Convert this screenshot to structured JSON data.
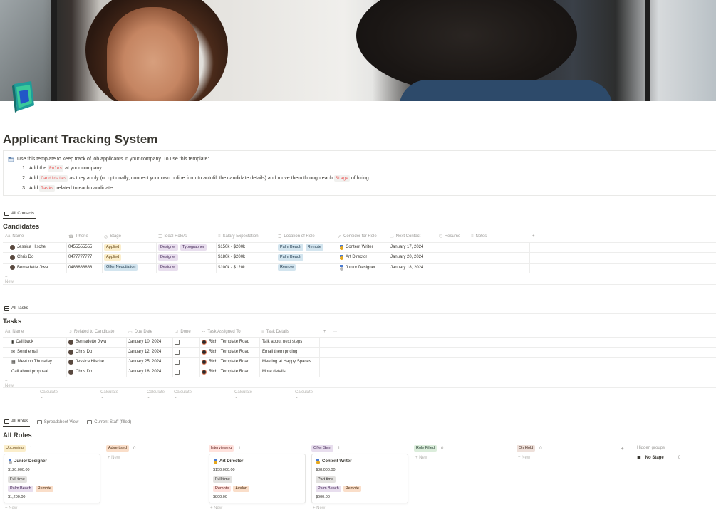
{
  "page": {
    "title": "Applicant Tracking System"
  },
  "callout": {
    "intro": "Use this template to keep track of job applicants in your company. To use this template:",
    "steps": [
      {
        "n": "1.",
        "before": "Add the",
        "code": "Roles",
        "after": "at your company"
      },
      {
        "n": "2.",
        "before": "Add",
        "code": "Candidates",
        "middle": "as they apply (or optionally, connect your own online form to autofill the candidate details) and move them through each",
        "code2": "Stage",
        "after": "of hiring"
      },
      {
        "n": "3.",
        "before": "Add",
        "code": "Tasks",
        "after": "related to each candidate"
      }
    ]
  },
  "candidates": {
    "tab": "All Contacts",
    "title": "Candidates",
    "headers": {
      "name": "Name",
      "phone": "Phone",
      "stage": "Stage",
      "ideal_roles": "Ideal Role/s",
      "salary": "Salary Expectation",
      "location": "Location of Role",
      "consider": "Consider for Role",
      "next_contact": "Next Contact",
      "resume": "Resume",
      "notes": "Notes"
    },
    "name_glyph": "Aa",
    "add_col": "+",
    "more": "···",
    "rows": [
      {
        "name": "Jessica Hische",
        "phone": "0455555555",
        "stage": "Applied",
        "roles": [
          "Designer",
          "Typographer"
        ],
        "salary": "$150k - $200k",
        "locations": [
          "Palm Beach",
          "Remote"
        ],
        "consider": "Content Writer",
        "next_contact": "January 17, 2024"
      },
      {
        "name": "Chris Do",
        "phone": "0477777777",
        "stage": "Applied",
        "roles": [
          "Designer"
        ],
        "salary": "$180k - $200k",
        "locations": [
          "Palm Beach"
        ],
        "consider": "Art Director",
        "next_contact": "January 20, 2024"
      },
      {
        "name": "Bernadette Jiwa",
        "phone": "0488888888",
        "stage": "Offer Negotiation",
        "roles": [
          "Designer"
        ],
        "salary": "$100k - $120k",
        "locations": [
          "Remote"
        ],
        "consider": "Junior Designer",
        "next_contact": "January 18, 2024"
      }
    ],
    "new_label": "+ New"
  },
  "tasks": {
    "tab": "All Tasks",
    "title": "Tasks",
    "headers": {
      "name": "Name",
      "related": "Related to Candidate",
      "due": "Due Date",
      "done": "Done",
      "assigned": "Task Assigned To",
      "details": "Task Details"
    },
    "rows": [
      {
        "icon": "phone-icon",
        "name": "Call back",
        "related": "Bernadette Jiwa",
        "due": "January 10, 2024",
        "assigned": "Rich | Template Road",
        "details": "Talk about next steps"
      },
      {
        "icon": "envelope-icon",
        "name": "Send email",
        "related": "Chris Do",
        "due": "January 12, 2024",
        "assigned": "Rich | Template Road",
        "details": "Email them pricing"
      },
      {
        "icon": "calendar-icon",
        "name": "Meet on Thursday",
        "related": "Jessica Hische",
        "due": "January 25, 2024",
        "assigned": "Rich | Template Road",
        "details": "Meeting at Happy Spaces"
      },
      {
        "icon": "",
        "name": "Call about proposal",
        "related": "Chris Do",
        "due": "January 18, 2024",
        "assigned": "Rich | Template Road",
        "details": "More details..."
      }
    ],
    "new_label": "+ New",
    "calculate": "Calculate"
  },
  "roles": {
    "tabs": [
      "All Roles",
      "Spreadsheet View",
      "Current Staff (filled)"
    ],
    "title": "All Roles",
    "groups": [
      {
        "label": "Upcoming",
        "count": "1",
        "color": "tag-yellow"
      },
      {
        "label": "Advertised",
        "count": "0",
        "color": "tag-orange"
      },
      {
        "label": "Interviewing",
        "count": "1",
        "color": "tag-red"
      },
      {
        "label": "Offer Sent",
        "count": "1",
        "color": "tag-purple"
      },
      {
        "label": "Role Filled",
        "count": "0",
        "color": "tag-green"
      },
      {
        "label": "On Hold",
        "count": "0",
        "color": "tag-brown"
      }
    ],
    "hidden_groups": "Hidden groups",
    "no_stage": "No Stage",
    "no_stage_count": "0",
    "add_group": "+",
    "new_label": "+ New",
    "cards": [
      {
        "title": "Junior Designer",
        "medal": "silver",
        "salary": "$120,000.00",
        "type": "Full time",
        "locations": [
          "Palm Beach",
          "Remote"
        ],
        "extra": "$1,200.00"
      },
      {
        "title": "Art Director",
        "medal": "gold",
        "salary": "$150,000.00",
        "type": "Full time",
        "locations": [
          "Remote",
          "Avalon"
        ],
        "extra": "$800.00"
      },
      {
        "title": "Content Writer",
        "medal": "gold",
        "salary": "$88,000.00",
        "type": "Part time",
        "locations": [
          "Palm Beach",
          "Remote"
        ],
        "extra": "$600.00"
      }
    ]
  }
}
